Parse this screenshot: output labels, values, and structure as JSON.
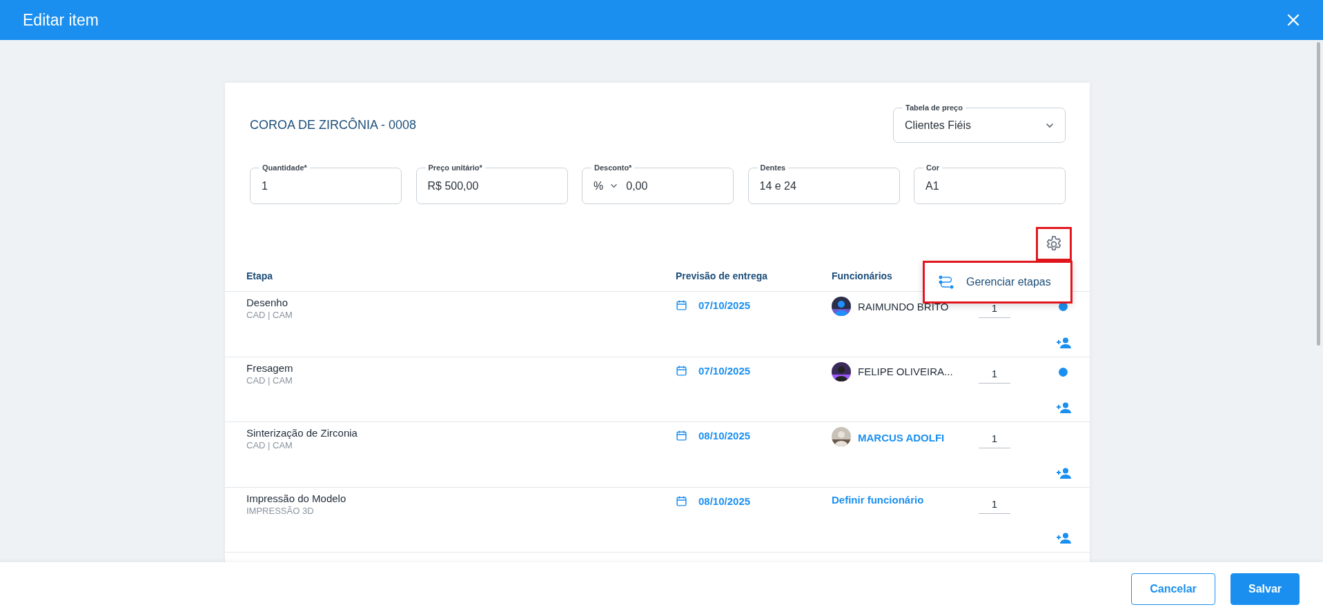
{
  "window": {
    "title": "Editar item"
  },
  "item": {
    "title": "COROA DE ZIRCÔNIA - 0008"
  },
  "price_table": {
    "label": "Tabela de preço",
    "value": "Clientes Fiéis"
  },
  "fields": [
    {
      "kind": "text",
      "label": "Quantidade*",
      "value": "1"
    },
    {
      "kind": "text",
      "label": "Preço unitário*",
      "value": "R$ 500,00"
    },
    {
      "kind": "discount",
      "label": "Desconto*",
      "unit": "%",
      "value": "0,00"
    },
    {
      "kind": "text",
      "label": "Dentes",
      "value": "14 e 24"
    },
    {
      "kind": "text",
      "label": "Cor",
      "value": "A1"
    }
  ],
  "settings_button": {
    "highlighted": true
  },
  "stage_menu": {
    "open": true,
    "highlighted": true,
    "items": [
      {
        "label": "Gerenciar etapas"
      }
    ]
  },
  "table": {
    "columns": [
      "Etapa",
      "Previsão de entrega",
      "Funcionários"
    ],
    "rows": [
      {
        "name": "Desenho",
        "category": "CAD | CAM",
        "date": "07/10/2025",
        "employee": {
          "kind": "assigned",
          "name": "RAIMUNDO BRITO"
        },
        "quantity": "1",
        "active": true
      },
      {
        "name": "Fresagem",
        "category": "CAD | CAM",
        "date": "07/10/2025",
        "employee": {
          "kind": "assigned",
          "name": "FELIPE OLIVEIRA..."
        },
        "quantity": "1",
        "active": true
      },
      {
        "name": "Sinterização de Zirconia",
        "category": "CAD | CAM",
        "date": "08/10/2025",
        "employee": {
          "kind": "assigned_link",
          "name": "MARCUS ADOLFI"
        },
        "quantity": "1",
        "active": false
      },
      {
        "name": "Impressão do Modelo",
        "category": "IMPRESSÃO 3D",
        "date": "08/10/2025",
        "employee": {
          "kind": "unassigned",
          "name": "Definir funcionário"
        },
        "quantity": "1",
        "active": false
      }
    ]
  },
  "buttons": [
    {
      "label": "Cancelar",
      "kind": "secondary"
    },
    {
      "label": "Salvar",
      "kind": "primary"
    }
  ]
}
